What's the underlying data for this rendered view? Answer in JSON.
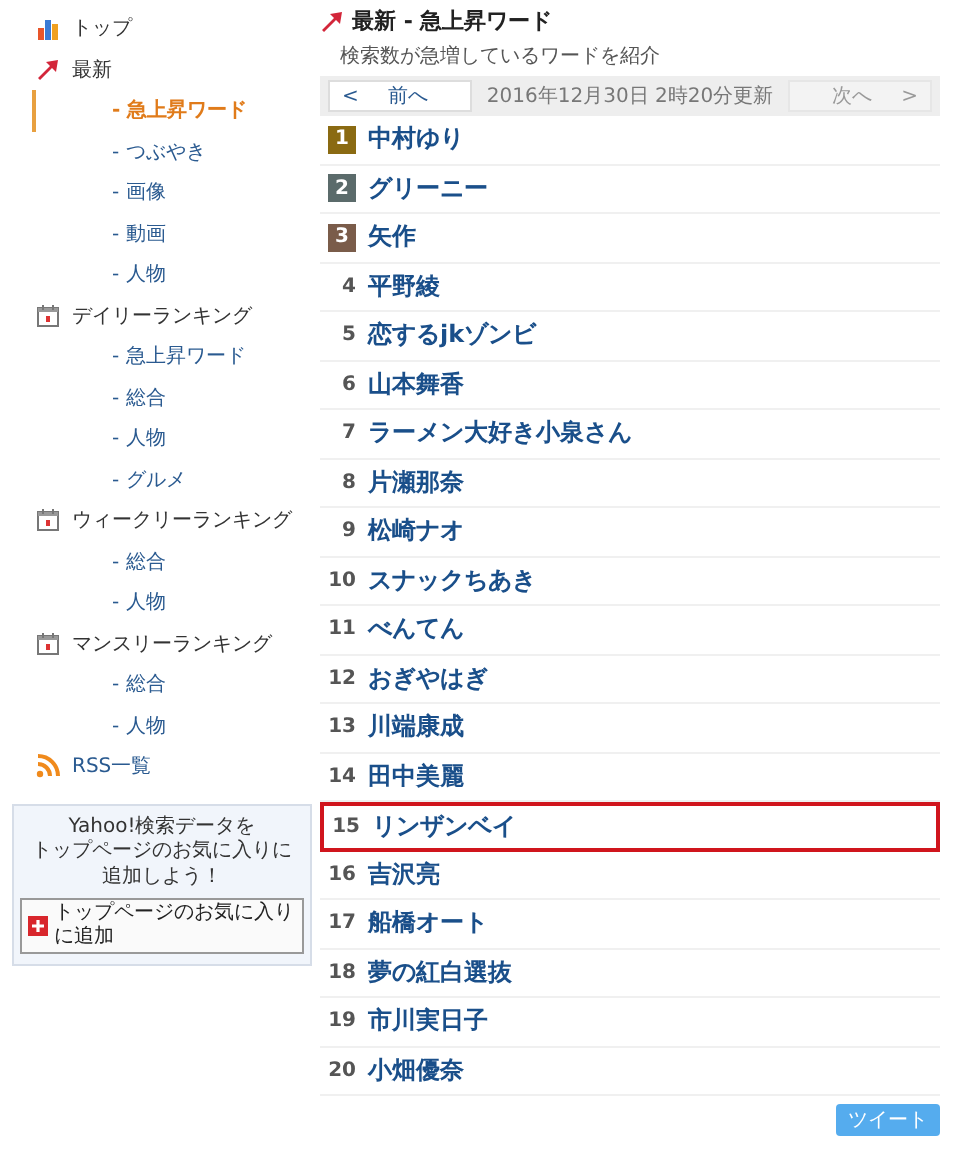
{
  "sidebar": {
    "items": [
      {
        "kind": "top",
        "label": "トップ"
      },
      {
        "kind": "latest",
        "label": "最新",
        "children": [
          {
            "label": "- 急上昇ワード",
            "selected": true
          },
          {
            "label": "- つぶやき",
            "selected": false
          },
          {
            "label": "- 画像",
            "selected": false
          },
          {
            "label": "- 動画",
            "selected": false
          },
          {
            "label": "- 人物",
            "selected": false
          }
        ]
      },
      {
        "kind": "calendar",
        "label": "デイリーランキング",
        "children": [
          {
            "label": "- 急上昇ワード",
            "selected": false
          },
          {
            "label": "- 総合",
            "selected": false
          },
          {
            "label": "- 人物",
            "selected": false
          },
          {
            "label": "- グルメ",
            "selected": false
          }
        ]
      },
      {
        "kind": "calendar",
        "label": "ウィークリーランキング",
        "children": [
          {
            "label": "- 総合",
            "selected": false
          },
          {
            "label": "- 人物",
            "selected": false
          }
        ]
      },
      {
        "kind": "calendar",
        "label": "マンスリーランキング",
        "children": [
          {
            "label": "- 総合",
            "selected": false
          },
          {
            "label": "- 人物",
            "selected": false
          }
        ]
      },
      {
        "kind": "rss",
        "label": "RSS一覧"
      }
    ],
    "promo": {
      "lines": [
        "Yahoo!検索データを",
        "トップページのお気に入りに",
        "追加しよう！"
      ],
      "button": "トップページのお気に入りに追加"
    }
  },
  "header": {
    "title": "最新 - 急上昇ワード",
    "subtitle": "検索数が急増しているワードを紹介"
  },
  "pager": {
    "prev": {
      "arrow": "<",
      "label": "前へ",
      "disabled": false
    },
    "updated": "2016年12月30日 2時20分更新",
    "next": {
      "arrow": ">",
      "label": "次へ",
      "disabled": true
    }
  },
  "ranking": [
    {
      "rank": "1",
      "name": "中村ゆり",
      "color": "#8a6a12",
      "highlighted": false
    },
    {
      "rank": "2",
      "name": "グリーニー",
      "color": "#5b6b6b",
      "highlighted": false
    },
    {
      "rank": "3",
      "name": "矢作",
      "color": "#7a5c4a",
      "highlighted": false
    },
    {
      "rank": "4",
      "name": "平野綾",
      "highlighted": false
    },
    {
      "rank": "5",
      "name": "恋するjkゾンビ",
      "highlighted": false
    },
    {
      "rank": "6",
      "name": "山本舞香",
      "highlighted": false
    },
    {
      "rank": "7",
      "name": "ラーメン大好き小泉さん",
      "highlighted": false
    },
    {
      "rank": "8",
      "name": "片瀬那奈",
      "highlighted": false
    },
    {
      "rank": "9",
      "name": "松崎ナオ",
      "highlighted": false
    },
    {
      "rank": "10",
      "name": "スナックちあき",
      "highlighted": false
    },
    {
      "rank": "11",
      "name": "べんてん",
      "highlighted": false
    },
    {
      "rank": "12",
      "name": "おぎやはぎ",
      "highlighted": false
    },
    {
      "rank": "13",
      "name": "川端康成",
      "highlighted": false
    },
    {
      "rank": "14",
      "name": "田中美麗",
      "highlighted": false
    },
    {
      "rank": "15",
      "name": "リンザンベイ",
      "highlighted": true
    },
    {
      "rank": "16",
      "name": "吉沢亮",
      "highlighted": false
    },
    {
      "rank": "17",
      "name": "船橋オート",
      "highlighted": false
    },
    {
      "rank": "18",
      "name": "夢の紅白選抜",
      "highlighted": false
    },
    {
      "rank": "19",
      "name": "市川実日子",
      "highlighted": false
    },
    {
      "rank": "20",
      "name": "小畑優奈",
      "highlighted": false
    }
  ],
  "tweet_button": "ツイート"
}
